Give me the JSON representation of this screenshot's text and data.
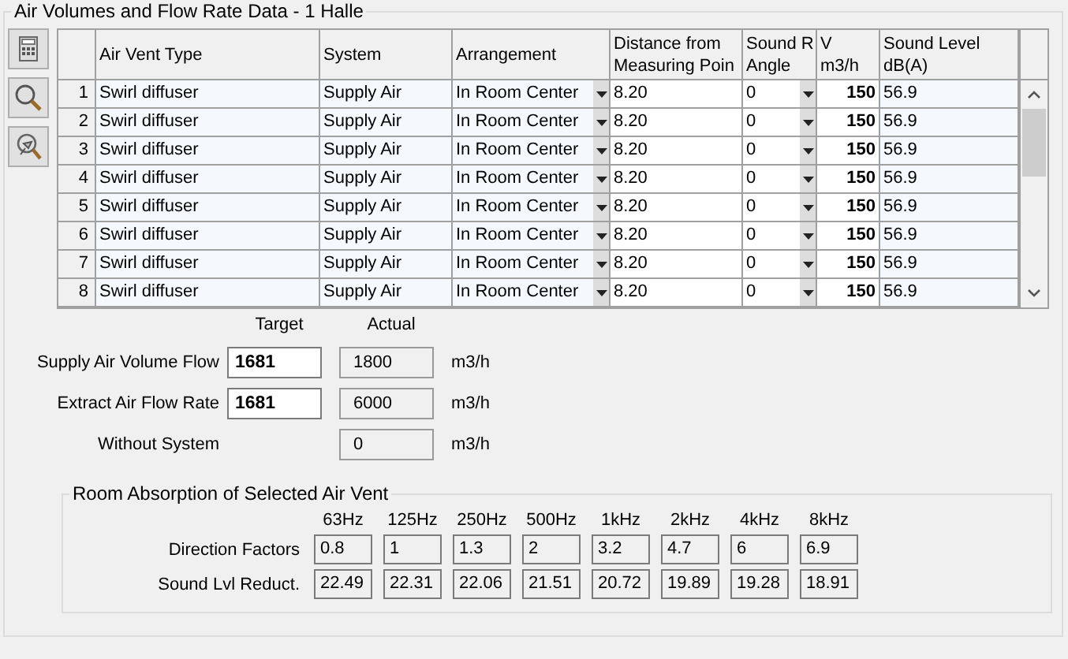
{
  "group_title": "Air Volumes and Flow Rate Data - 1 Halle",
  "toolbar": [
    {
      "kind": "calculator"
    },
    {
      "kind": "search"
    },
    {
      "kind": "pin-search"
    }
  ],
  "table": {
    "columns": [
      {
        "kind": "num"
      },
      {
        "lines": [
          "Air Vent Type"
        ],
        "kind": "text"
      },
      {
        "lines": [
          "System"
        ],
        "kind": "text"
      },
      {
        "lines": [
          "Arrangement"
        ],
        "kind": "dropdown"
      },
      {
        "lines": [
          "Distance from",
          "Measuring Poin"
        ],
        "kind": "edit"
      },
      {
        "lines": [
          "Sound R",
          "Angle"
        ],
        "kind": "dropdown-edit"
      },
      {
        "lines": [
          "V",
          "m3/h"
        ],
        "kind": "bold"
      },
      {
        "lines": [
          "Sound Level",
          "dB(A)"
        ],
        "kind": "text"
      }
    ],
    "rows": [
      [
        "1",
        "Swirl diffuser",
        "Supply Air",
        "In Room Center",
        "8.20",
        "0",
        "150",
        "56.9"
      ],
      [
        "2",
        "Swirl diffuser",
        "Supply Air",
        "In Room Center",
        "8.20",
        "0",
        "150",
        "56.9"
      ],
      [
        "3",
        "Swirl diffuser",
        "Supply Air",
        "In Room Center",
        "8.20",
        "0",
        "150",
        "56.9"
      ],
      [
        "4",
        "Swirl diffuser",
        "Supply Air",
        "In Room Center",
        "8.20",
        "0",
        "150",
        "56.9"
      ],
      [
        "5",
        "Swirl diffuser",
        "Supply Air",
        "In Room Center",
        "8.20",
        "0",
        "150",
        "56.9"
      ],
      [
        "6",
        "Swirl diffuser",
        "Supply Air",
        "In Room Center",
        "8.20",
        "0",
        "150",
        "56.9"
      ],
      [
        "7",
        "Swirl diffuser",
        "Supply Air",
        "In Room Center",
        "8.20",
        "0",
        "150",
        "56.9"
      ],
      [
        "8",
        "Swirl diffuser",
        "Supply Air",
        "In Room Center",
        "8.20",
        "0",
        "150",
        "56.9"
      ]
    ]
  },
  "flows": {
    "headers": [
      "Target",
      "Actual"
    ],
    "rows": [
      {
        "label": "Supply Air Volume Flow",
        "target": "1681",
        "actual": "1800",
        "unit": "m3/h"
      },
      {
        "label": "Extract Air Flow Rate",
        "target": "1681",
        "actual": "6000",
        "unit": "m3/h"
      },
      {
        "label": "Without System",
        "actual": "0",
        "unit": "m3/h"
      }
    ]
  },
  "absorption": {
    "title": "Room Absorption of Selected Air Vent",
    "bands": [
      "63Hz",
      "125Hz",
      "250Hz",
      "500Hz",
      "1kHz",
      "2kHz",
      "4kHz",
      "8kHz"
    ],
    "rows": [
      {
        "label": "Direction Factors",
        "values": [
          "0.8",
          "1",
          "1.3",
          "2",
          "3.2",
          "4.7",
          "6",
          "6.9"
        ]
      },
      {
        "label": "Sound Lvl Reduct.",
        "values": [
          "22.49",
          "22.31",
          "22.06",
          "21.51",
          "20.72",
          "19.89",
          "19.28",
          "18.91"
        ]
      }
    ]
  }
}
